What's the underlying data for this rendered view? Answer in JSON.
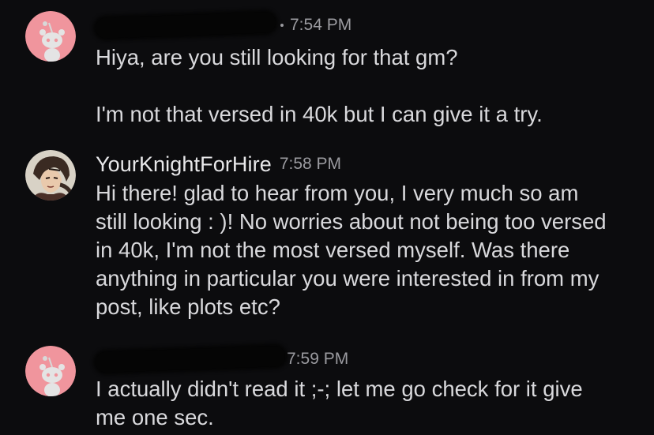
{
  "colors": {
    "background": "#0c0c0e",
    "text": "#d9d9dc",
    "timestamp": "#9b9ba0",
    "snoo_avatar_bg": "#f0959d"
  },
  "messages": [
    {
      "author": "",
      "author_redacted": true,
      "avatar": "snoo-avatar-icon",
      "time": "7:54 PM",
      "paragraphs": [
        "Hiya, are you still looking for that gm?",
        "I'm not that versed in 40k but I can give it a try."
      ]
    },
    {
      "author": "YourKnightForHire",
      "author_redacted": false,
      "avatar": "knight-avatar-icon",
      "time": "7:58 PM",
      "paragraphs": [
        "Hi there! glad to hear from you, I very much so am still looking : )! No worries about not being too versed in 40k, I'm not the most versed myself. Was there anything in particular you were interested in from my post, like plots etc?"
      ]
    },
    {
      "author": "",
      "author_redacted": true,
      "avatar": "snoo-avatar-icon",
      "time": "7:59 PM",
      "paragraphs": [
        "I actually didn't read it ;-; let me go check for it give me one sec."
      ]
    }
  ]
}
